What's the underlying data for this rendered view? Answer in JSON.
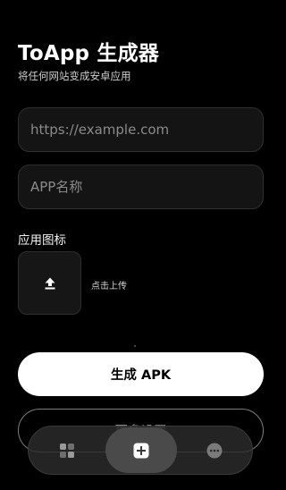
{
  "header": {
    "title": "ToApp 生成器",
    "subtitle": "将任何网站变成安卓应用"
  },
  "form": {
    "url_placeholder": "https://example.com",
    "url_value": "",
    "name_placeholder": "APP名称",
    "name_value": ""
  },
  "icon_section": {
    "label": "应用图标",
    "upload_hint": "点击上传",
    "upload_icon": "upload-arrow-icon"
  },
  "actions": {
    "generate_label": "生成 APK",
    "more_settings_label": "更多设置"
  },
  "tabbar": {
    "items": [
      {
        "icon": "apps-grid-icon"
      },
      {
        "icon": "add-square-icon",
        "active": true
      },
      {
        "icon": "more-circle-icon"
      }
    ]
  },
  "colors": {
    "background": "#000000",
    "primary_button": "#ffffff",
    "field_background": "#141414",
    "tabbar_background": "#2c2c2c"
  }
}
